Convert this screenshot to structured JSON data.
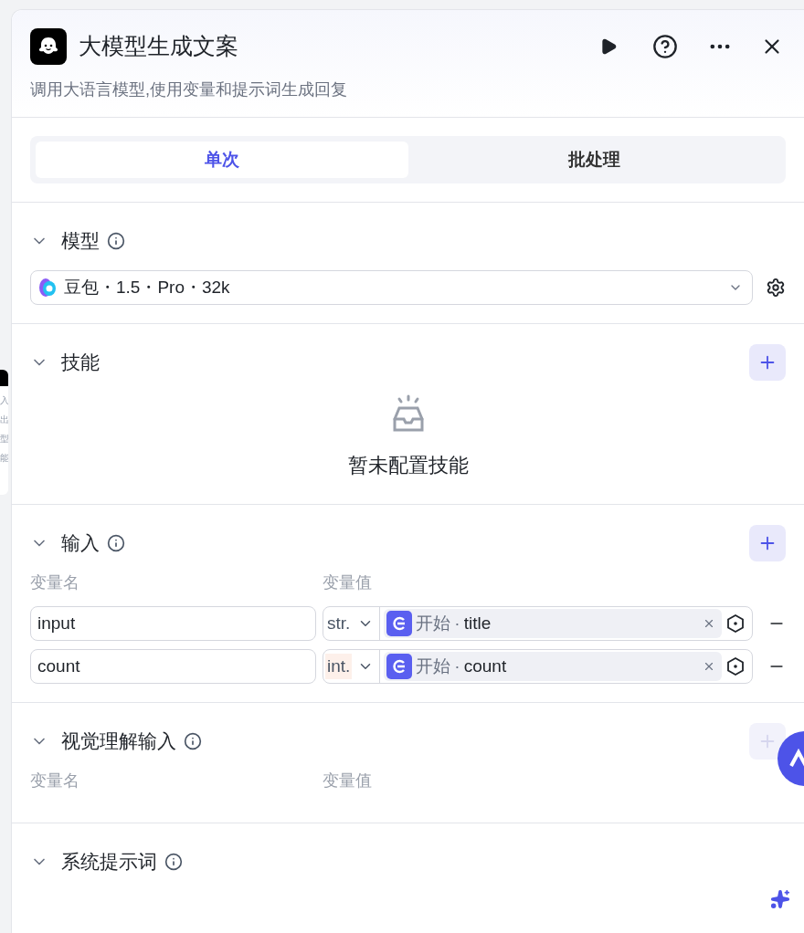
{
  "header": {
    "title": "大模型生成文案",
    "description": "调用大语言模型,使用变量和提示词生成回复"
  },
  "left_rail": {
    "labels": [
      "入",
      "出",
      "型",
      "能"
    ]
  },
  "tabs": [
    {
      "label": "单次",
      "selected": true
    },
    {
      "label": "批处理",
      "selected": false
    }
  ],
  "sections": [
    {
      "kind": "model",
      "title": "模型",
      "info": true,
      "expanded": true,
      "model": "豆包・1.5・Pro・32k"
    },
    {
      "kind": "skills",
      "title": "技能",
      "expanded": true,
      "add_disabled": false,
      "empty_text": "暂未配置技能"
    },
    {
      "kind": "inputs",
      "title": "输入",
      "info": true,
      "expanded": true,
      "add_disabled": false,
      "columns": [
        "变量名",
        "变量值"
      ],
      "rows": [
        {
          "name": "input",
          "type": "str.",
          "type_highlighted": false,
          "source": "开始",
          "separator": "·",
          "field": "title"
        },
        {
          "name": "count",
          "type": "int.",
          "type_highlighted": true,
          "source": "开始",
          "separator": "·",
          "field": "count"
        }
      ]
    },
    {
      "kind": "inputs",
      "title": "视觉理解输入",
      "info": true,
      "expanded": true,
      "add_disabled": true,
      "columns": [
        "变量名",
        "变量值"
      ]
    },
    {
      "kind": "prompt",
      "title": "系统提示词",
      "info": true,
      "expanded": true
    }
  ]
}
